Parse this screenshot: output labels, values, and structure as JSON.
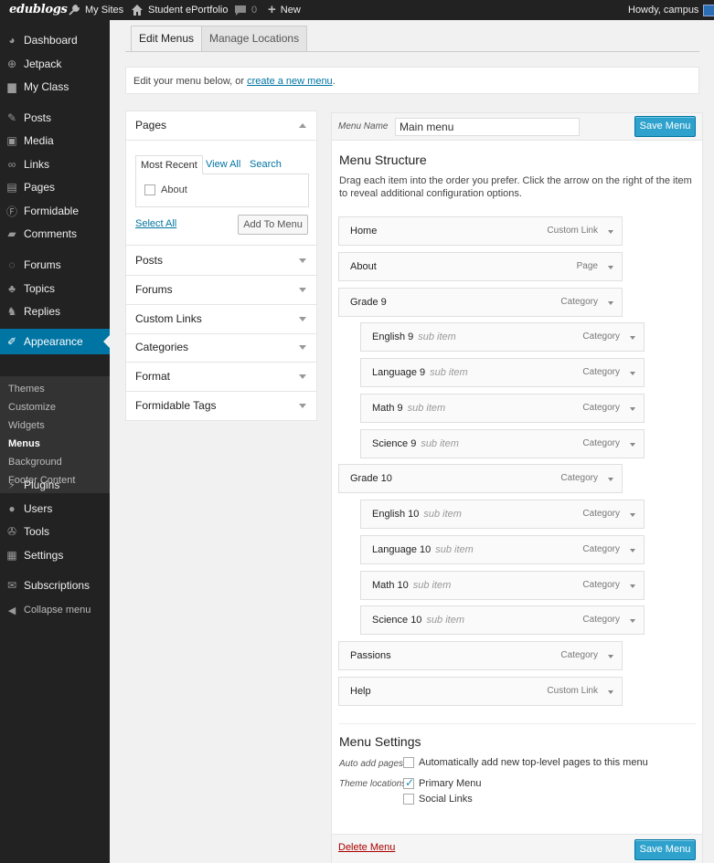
{
  "adminbar": {
    "logo": "edublogs",
    "my_sites": "My Sites",
    "site_name": "Student ePortfolio",
    "comments_count": "0",
    "new_label": "New",
    "greeting": "Howdy, campus"
  },
  "sidebar": {
    "items": [
      {
        "label": "Dashboard",
        "icon": "dashboard-icon"
      },
      {
        "label": "Jetpack",
        "icon": "jetpack-icon"
      },
      {
        "label": "My Class",
        "icon": "class-icon"
      },
      {
        "label": "Posts",
        "icon": "pin-icon"
      },
      {
        "label": "Media",
        "icon": "media-icon"
      },
      {
        "label": "Links",
        "icon": "link-icon"
      },
      {
        "label": "Pages",
        "icon": "page-icon"
      },
      {
        "label": "Formidable",
        "icon": "formidable-icon"
      },
      {
        "label": "Comments",
        "icon": "comment-icon"
      },
      {
        "label": "Forums",
        "icon": "forums-icon"
      },
      {
        "label": "Topics",
        "icon": "topics-icon"
      },
      {
        "label": "Replies",
        "icon": "replies-icon"
      },
      {
        "label": "Appearance",
        "icon": "brush-icon"
      },
      {
        "label": "Plugins",
        "icon": "plugin-icon"
      },
      {
        "label": "Users",
        "icon": "user-icon"
      },
      {
        "label": "Tools",
        "icon": "wrench-icon"
      },
      {
        "label": "Settings",
        "icon": "settings-icon"
      },
      {
        "label": "Subscriptions",
        "icon": "mail-icon"
      },
      {
        "label": "Collapse menu",
        "icon": "collapse-icon"
      }
    ],
    "submenu": [
      "Themes",
      "Customize",
      "Widgets",
      "Menus",
      "Background",
      "Footer Content"
    ]
  },
  "tabs": {
    "edit": "Edit Menus",
    "manage": "Manage Locations"
  },
  "notice": {
    "text": "Edit your menu below, or ",
    "link": "create a new menu",
    "end": "."
  },
  "left": {
    "pages_title": "Pages",
    "inner_tabs": [
      "Most Recent",
      "View All",
      "Search"
    ],
    "page_item": "About",
    "select_all": "Select All",
    "add_to_menu": "Add To Menu",
    "sections": [
      "Posts",
      "Forums",
      "Custom Links",
      "Categories",
      "Format",
      "Formidable Tags"
    ]
  },
  "right": {
    "menu_name_label": "Menu Name",
    "menu_name_value": "Main menu",
    "save": "Save Menu",
    "structure_title": "Menu Structure",
    "structure_desc": "Drag each item into the order you prefer. Click the arrow on the right of the item to reveal additional configuration options.",
    "items": [
      {
        "title": "Home",
        "type": "Custom Link",
        "sub": false
      },
      {
        "title": "About",
        "type": "Page",
        "sub": false
      },
      {
        "title": "Grade 9",
        "type": "Category",
        "sub": false
      },
      {
        "title": "English 9",
        "type": "Category",
        "sub": true
      },
      {
        "title": "Language 9",
        "type": "Category",
        "sub": true
      },
      {
        "title": "Math 9",
        "type": "Category",
        "sub": true
      },
      {
        "title": "Science 9",
        "type": "Category",
        "sub": true
      },
      {
        "title": "Grade 10",
        "type": "Category",
        "sub": false
      },
      {
        "title": "English 10",
        "type": "Category",
        "sub": true
      },
      {
        "title": "Language 10",
        "type": "Category",
        "sub": true
      },
      {
        "title": "Math 10",
        "type": "Category",
        "sub": true
      },
      {
        "title": "Science 10",
        "type": "Category",
        "sub": true
      },
      {
        "title": "Passions",
        "type": "Category",
        "sub": false
      },
      {
        "title": "Help",
        "type": "Custom Link",
        "sub": false
      }
    ],
    "sub_item_label": "sub item",
    "settings_title": "Menu Settings",
    "auto_add_label": "Auto add pages",
    "auto_add_text": "Automatically add new top-level pages to this menu",
    "theme_locations_label": "Theme locations",
    "primary_menu": "Primary Menu",
    "social_links": "Social Links",
    "delete": "Delete Menu"
  },
  "colors": {
    "accent": "#0074a2",
    "button": "#2ea2cc",
    "sidebar": "#222222"
  }
}
